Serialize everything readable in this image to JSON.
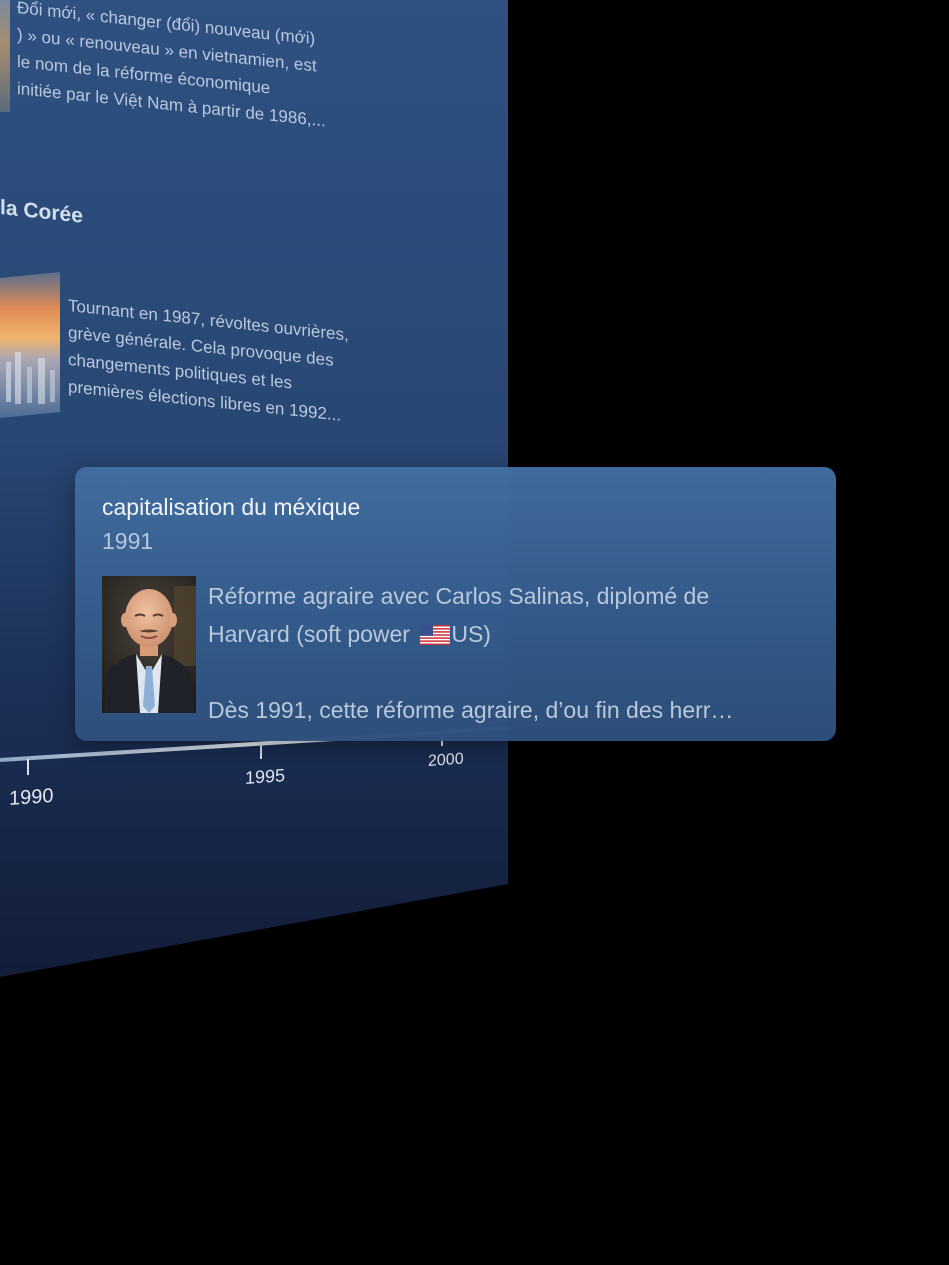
{
  "background": {
    "paragraph_1": [
      "Đổi mới, « changer (đổi) nouveau (mới)",
      ") » ou « renouveau » en vietnamien, est",
      "le nom de la réforme économique",
      "initiée par le Việt Nam à partir de 1986,..."
    ],
    "heading_2": "la Corée",
    "paragraph_2": [
      "Tournant en 1987, révoltes ouvrières,",
      "grève générale. Cela provoque des",
      "changements politiques et les",
      "premières élections libres en 1992..."
    ],
    "timeline": {
      "ticks": [
        "1990",
        "1995",
        "2000"
      ]
    }
  },
  "card": {
    "title": "capitalisation du méxique",
    "year": "1991",
    "description_line_1": "Réforme agraire avec Carlos Salinas, diplomé de",
    "description_line_2_before_flag": "Harvard (soft power ",
    "description_line_2_after_flag": "US)",
    "description_line_3": "Dès 1991, cette réforme agraire, d’ou fin des herr…",
    "flag_icon": "us-flag-icon"
  },
  "colors": {
    "page_background": "#000000",
    "panel_top": "#2d4f7d",
    "panel_bottom": "#13203c",
    "card_background": "#3f6a9c",
    "card_title_text": "#f1f5fb",
    "card_secondary_text": "#b9c8db"
  }
}
